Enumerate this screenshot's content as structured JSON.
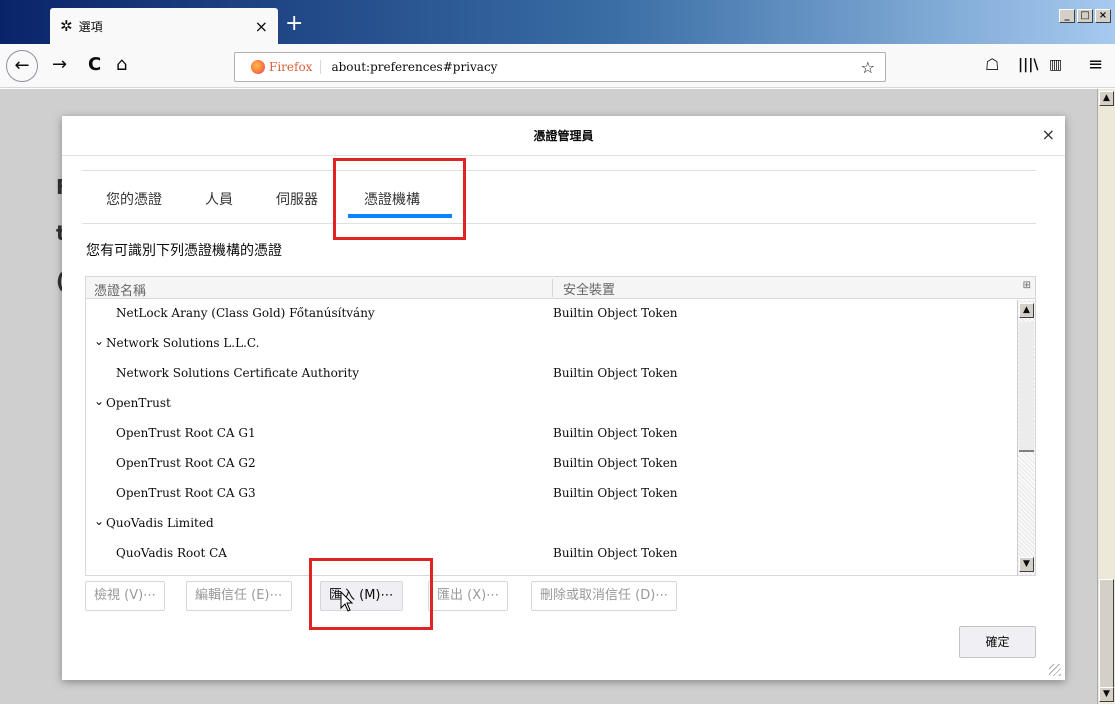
{
  "browser": {
    "tab_title": "選項",
    "url_identity": "Firefox",
    "url": "about:preferences#privacy"
  },
  "dialog": {
    "title": "憑證管理員",
    "tabs": [
      "您的憑證",
      "人員",
      "伺服器",
      "憑證機構"
    ],
    "active_tab": "憑證機構",
    "description": "您有可識別下列憑證機構的憑證",
    "columns": [
      "憑證名稱",
      "安全裝置"
    ],
    "rows": [
      {
        "name": "NetLock Arany (Class Gold) Főtanúsítvány",
        "device": "Builtin Object Token",
        "group": false
      },
      {
        "name": "Network Solutions L.L.C.",
        "device": "",
        "group": true
      },
      {
        "name": "Network Solutions Certificate Authority",
        "device": "Builtin Object Token",
        "group": false
      },
      {
        "name": "OpenTrust",
        "device": "",
        "group": true
      },
      {
        "name": "OpenTrust Root CA G1",
        "device": "Builtin Object Token",
        "group": false
      },
      {
        "name": "OpenTrust Root CA G2",
        "device": "Builtin Object Token",
        "group": false
      },
      {
        "name": "OpenTrust Root CA G3",
        "device": "Builtin Object Token",
        "group": false
      },
      {
        "name": "QuoVadis Limited",
        "device": "",
        "group": true
      },
      {
        "name": "QuoVadis Root CA",
        "device": "Builtin Object Token",
        "group": false
      }
    ],
    "buttons": {
      "view": "檢視 (V)⋯",
      "edit_trust": "編輯信任 (E)⋯",
      "import": "匯入 (M)⋯",
      "export": "匯出 (X)⋯",
      "delete": "刪除或取消信任 (D)⋯",
      "ok": "確定"
    }
  },
  "colors": {
    "accent": "#0a84ff",
    "highlight_box": "#e02424"
  }
}
